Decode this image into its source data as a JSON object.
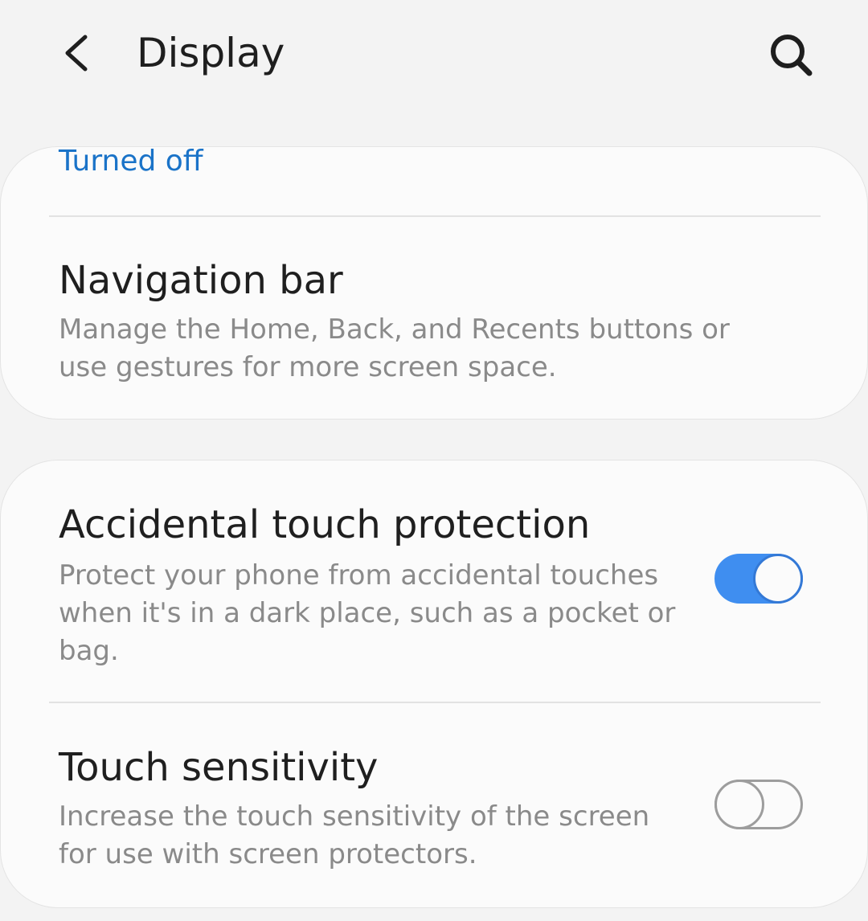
{
  "header": {
    "title": "Display"
  },
  "colors": {
    "accent": "#3f8ef0",
    "link": "#1a73c8",
    "background": "#f3f3f3",
    "card": "#fbfbfb"
  },
  "icons": {
    "back": "chevron-left-icon",
    "search": "search-icon"
  },
  "previous_item": {
    "status": "Turned off"
  },
  "navigation_bar": {
    "title": "Navigation bar",
    "description": "Manage the Home, Back, and Recents buttons or use gestures for more screen space."
  },
  "accidental_touch": {
    "title": "Accidental touch protection",
    "description": "Protect your phone from accidental touches when it's in a dark place, such as a pocket or bag.",
    "enabled": true
  },
  "touch_sensitivity": {
    "title": "Touch sensitivity",
    "description": "Increase the touch sensitivity of the screen for use with screen protectors.",
    "enabled": false
  }
}
